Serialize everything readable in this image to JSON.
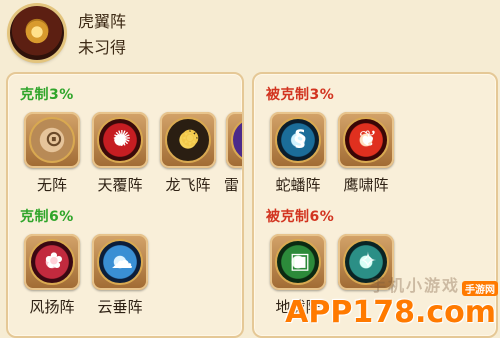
{
  "formation": {
    "name": "虎翼阵",
    "status": "未习得",
    "icon": "tiger-wing-formation-icon"
  },
  "counters": {
    "title": "克制3%",
    "items": [
      {
        "label": "无阵",
        "icon": "lock-icon",
        "color": "#c9a06a"
      },
      {
        "label": "天覆阵",
        "icon": "heaven-cover-icon",
        "color": "#a0151a"
      },
      {
        "label": "龙飞阵",
        "icon": "flying-dragon-icon",
        "color": "#231a10"
      },
      {
        "label": "雷",
        "icon": "thunder-icon",
        "color": "#4b2a8a"
      }
    ]
  },
  "counters_6": {
    "title": "克制6%",
    "items": [
      {
        "label": "风扬阵",
        "icon": "wind-rise-icon",
        "color": "#7a0f1f"
      },
      {
        "label": "云垂阵",
        "icon": "cloud-hang-icon",
        "color": "#12356e"
      }
    ]
  },
  "countered_by": {
    "title": "被克制3%",
    "items": [
      {
        "label": "蛇蟠阵",
        "icon": "coiled-snake-icon",
        "color": "#0f3a56"
      },
      {
        "label": "鹰啸阵",
        "icon": "eagle-cry-icon",
        "color": "#8a0f15"
      }
    ]
  },
  "countered_by_6": {
    "title": "被克制6%",
    "items": [
      {
        "label": "地载阵",
        "icon": "earth-bearing-icon",
        "color": "#1f6a2c"
      },
      {
        "label": "",
        "icon": "partial-formation-icon",
        "color": "#1a5a5a"
      }
    ]
  },
  "watermark": {
    "site": "APP178.com",
    "tag": "手游网",
    "faint": "手机小游戏"
  }
}
